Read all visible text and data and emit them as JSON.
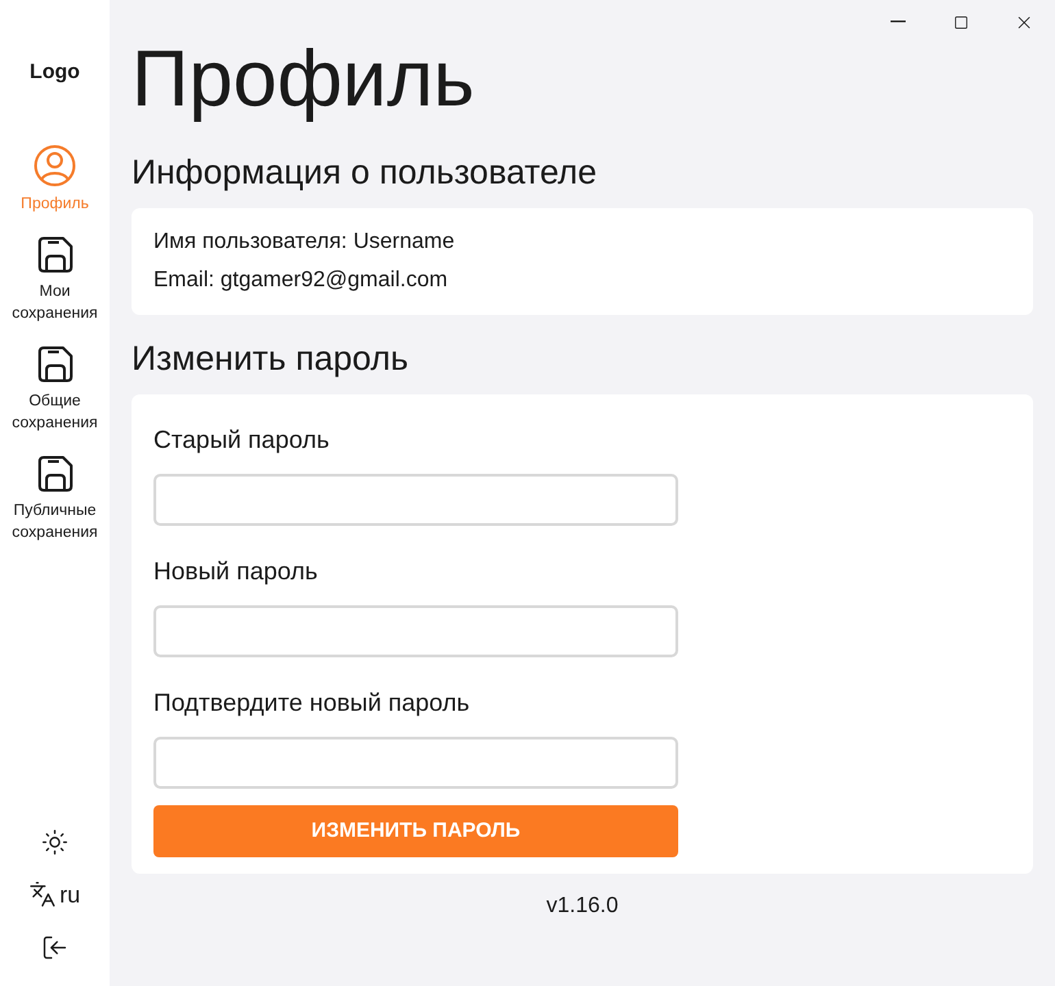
{
  "logo": "Logo",
  "nav": [
    {
      "label": "Профиль",
      "kind": "profile",
      "selected": true
    },
    {
      "label": "Мои сохранения",
      "kind": "saves",
      "selected": false
    },
    {
      "label": "Общие сохранения",
      "kind": "saves",
      "selected": false
    },
    {
      "label": "Публичные сохранения",
      "kind": "saves",
      "selected": false
    }
  ],
  "language": "ru",
  "title": "Профиль",
  "info": {
    "heading": "Информация о пользователе",
    "lines": [
      "Имя пользователя: Username",
      "Email: gtgamer92@gmail.com"
    ]
  },
  "password": {
    "heading": "Изменить пароль",
    "fields": [
      {
        "label": "Старый пароль"
      },
      {
        "label": "Новый пароль"
      },
      {
        "label": "Подтвердите новый пароль"
      }
    ],
    "button": "ИЗМЕНИТЬ ПАРОЛЬ"
  },
  "version": "v1.16.0"
}
